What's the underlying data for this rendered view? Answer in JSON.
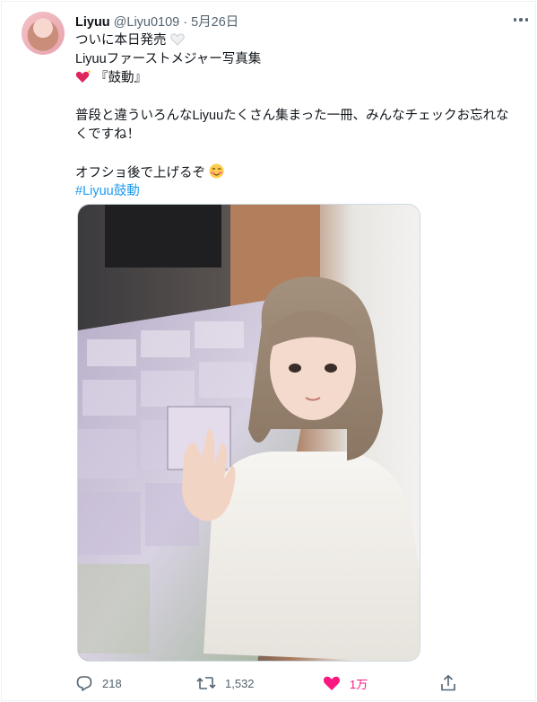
{
  "tweet": {
    "display_name": "Liyuu",
    "handle": "@Liyu0109",
    "separator": "·",
    "date": "5月26日",
    "text_lines": [
      "ついに本日発売",
      "Liyuuファーストメジャー写真集",
      "『鼓動』",
      "",
      "普段と違ういろんなLiyuuたくさん集まった一冊、みんなチェックお忘れな",
      "くですね！",
      "",
      "オフショ後で上げるぞ"
    ],
    "hashtag": "#Liyuu鼓動",
    "icons": {
      "avatar": "profile-avatar",
      "more": "more-options-icon",
      "white_heart": "white-heart-emoji",
      "red_heart": "sparkling-red-heart-emoji",
      "blush": "smiling-blush-emoji",
      "photo": "photo-selfie-with-photobooks"
    }
  },
  "actions": {
    "reply_count": "218",
    "retweet_count": "1,532",
    "like_count": "1万",
    "icons": [
      "reply-icon",
      "retweet-icon",
      "like-icon",
      "share-icon"
    ]
  },
  "colors": {
    "text": "#0f1419",
    "secondary": "#536471",
    "link": "#1d9bf0",
    "like": "#f91880",
    "border": "#cfd9de"
  }
}
